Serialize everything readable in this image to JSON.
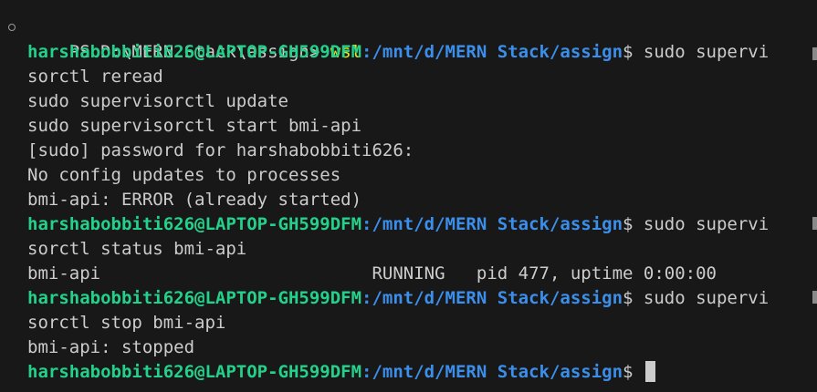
{
  "terminal": {
    "lines": [
      {
        "type": "ps",
        "prefix": "PS D:\\MERN Stack\\assign> ",
        "command": "wsl"
      },
      {
        "type": "prompt",
        "user": "harshabobbiti626@LAPTOP-GH599DFM",
        "path": ":/mnt/d/MERN Stack/assign",
        "suffix": "$ sudo supervi"
      },
      {
        "type": "text",
        "text": "sorctl reread"
      },
      {
        "type": "text",
        "text": "sudo supervisorctl update"
      },
      {
        "type": "text",
        "text": "sudo supervisorctl start bmi-api"
      },
      {
        "type": "text",
        "text": "[sudo] password for harshabobbiti626:"
      },
      {
        "type": "text",
        "text": "No config updates to processes"
      },
      {
        "type": "text",
        "text": "bmi-api: ERROR (already started)"
      },
      {
        "type": "prompt",
        "user": "harshabobbiti626@LAPTOP-GH599DFM",
        "path": ":/mnt/d/MERN Stack/assign",
        "suffix": "$ sudo supervi"
      },
      {
        "type": "text",
        "text": "sorctl status bmi-api"
      },
      {
        "type": "text",
        "text": "bmi-api                          RUNNING   pid 477, uptime 0:00:00"
      },
      {
        "type": "prompt",
        "user": "harshabobbiti626@LAPTOP-GH599DFM",
        "path": ":/mnt/d/MERN Stack/assign",
        "suffix": "$ sudo supervi"
      },
      {
        "type": "text",
        "text": "sorctl stop bmi-api"
      },
      {
        "type": "text",
        "text": "bmi-api: stopped"
      },
      {
        "type": "prompt",
        "user": "harshabobbiti626@LAPTOP-GH599DFM",
        "path": ":/mnt/d/MERN Stack/assign",
        "suffix": "$ "
      }
    ]
  },
  "colors": {
    "background": "#181818",
    "text": "#cccccc",
    "user": "#23d18b",
    "path": "#3b8eea",
    "wsl_command": "#e5e510"
  },
  "icons": {
    "command_marker": "circle-outline-icon",
    "cursor": "block-cursor-icon"
  }
}
